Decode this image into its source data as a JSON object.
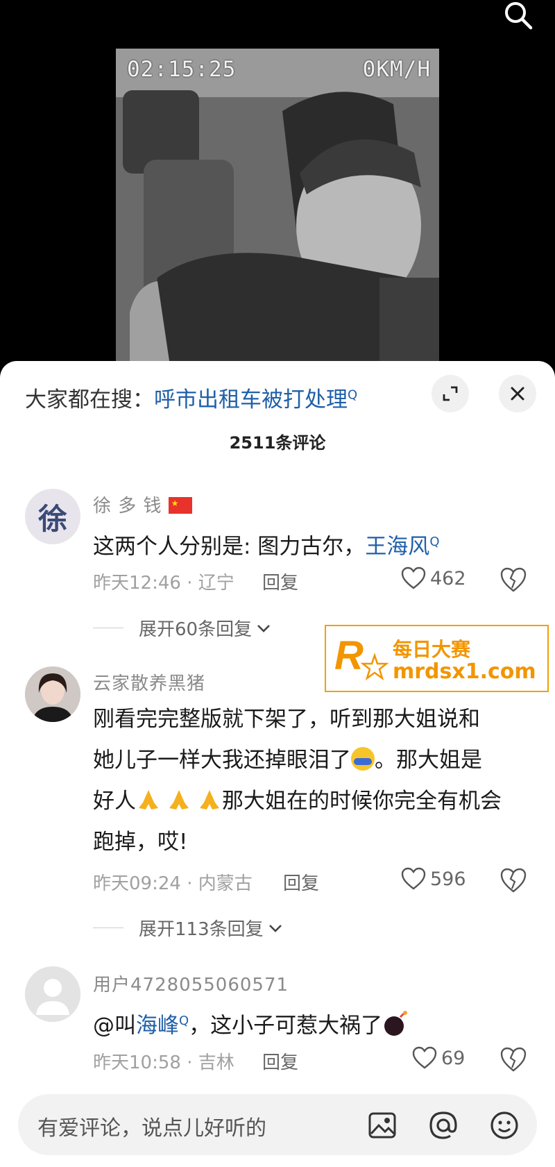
{
  "video": {
    "timestamp": "02:15:25",
    "speed": "0KM/H"
  },
  "panel": {
    "search_prefix": "大家都在搜：",
    "search_term": "呼市出租车被打处理",
    "comment_count": "2511条评论"
  },
  "comments": [
    {
      "username": "徐 多 钱",
      "avatar_text": "徐",
      "text_prefix": "这两个人分别是: 图力古尔，",
      "text_link": "王海风",
      "time_location": "昨天12:46 · 辽宁",
      "reply_label": "回复",
      "likes": "462",
      "expand_label": "展开60条回复"
    },
    {
      "username": "云家散养黑猪",
      "text_line1": "刚看完完整版就下架了，听到那大姐说和",
      "text_line2a": "她儿子一样大我还掉眼泪了",
      "text_line2b": "。那大姐是",
      "text_line3a": "好人",
      "text_line3b": "那大姐在的时候你完全有机会",
      "text_line4": "跑掉，哎!",
      "time_location": "昨天09:24 · 内蒙古",
      "reply_label": "回复",
      "likes": "596",
      "expand_label": "展开113条回复"
    },
    {
      "username": "用户4728055060571",
      "text_prefix": "@叫",
      "text_link": "海峰",
      "text_suffix": "，这小子可惹大祸了",
      "time_location": "昨天10:58 · 吉林",
      "reply_label": "回复",
      "likes": "69"
    }
  ],
  "watermark": {
    "title": "每日大赛",
    "url": "mrdsx1.com"
  },
  "input": {
    "placeholder": "有爱评论，说点儿好听的"
  },
  "colors": {
    "link": "#1f5fa8",
    "watermark": "#f29500"
  }
}
